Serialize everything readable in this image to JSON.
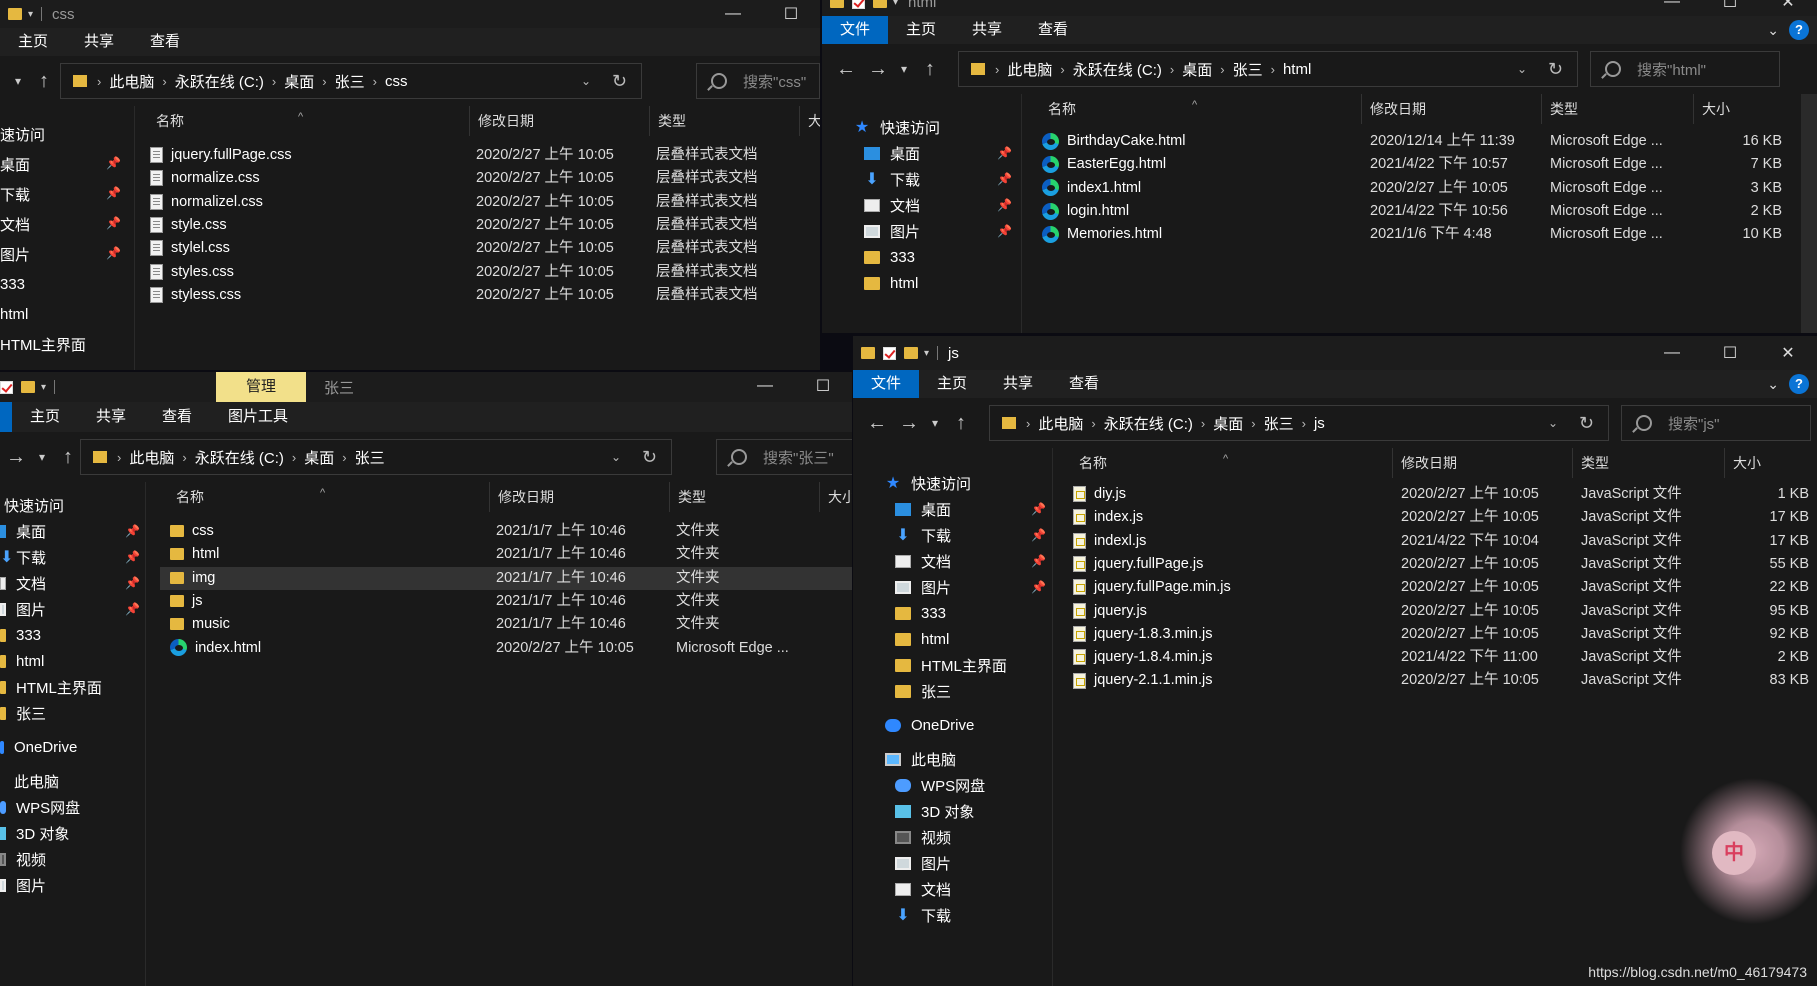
{
  "css_window": {
    "title": "css",
    "tabs": [
      "主页",
      "共享",
      "查看"
    ],
    "breadcrumb": [
      "此电脑",
      "永跃在线 (C:)",
      "桌面",
      "张三",
      "css"
    ],
    "search_placeholder": "搜索\"css\"",
    "sidebar": [
      "速访问",
      "桌面",
      "下载",
      "文档",
      "图片",
      "333",
      "html",
      "HTML主界面"
    ],
    "columns": [
      "名称",
      "修改日期",
      "类型",
      "大"
    ],
    "files": [
      {
        "name": "jquery.fullPage.css",
        "date": "2020/2/27 上午 10:05",
        "type": "层叠样式表文档"
      },
      {
        "name": "normalize.css",
        "date": "2020/2/27 上午 10:05",
        "type": "层叠样式表文档"
      },
      {
        "name": "normalizel.css",
        "date": "2020/2/27 上午 10:05",
        "type": "层叠样式表文档"
      },
      {
        "name": "style.css",
        "date": "2020/2/27 上午 10:05",
        "type": "层叠样式表文档"
      },
      {
        "name": "stylel.css",
        "date": "2020/2/27 上午 10:05",
        "type": "层叠样式表文档"
      },
      {
        "name": "styles.css",
        "date": "2020/2/27 上午 10:05",
        "type": "层叠样式表文档"
      },
      {
        "name": "styless.css",
        "date": "2020/2/27 上午 10:05",
        "type": "层叠样式表文档"
      }
    ]
  },
  "html_window": {
    "title": "html",
    "tabs": [
      "文件",
      "主页",
      "共享",
      "查看"
    ],
    "breadcrumb": [
      "此电脑",
      "永跃在线 (C:)",
      "桌面",
      "张三",
      "html"
    ],
    "search_placeholder": "搜索\"html\"",
    "sidebar": [
      "快速访问",
      "桌面",
      "下载",
      "文档",
      "图片",
      "333",
      "html"
    ],
    "columns": [
      "名称",
      "修改日期",
      "类型",
      "大小"
    ],
    "files": [
      {
        "name": "BirthdayCake.html",
        "date": "2020/12/14 上午 11:39",
        "type": "Microsoft Edge ...",
        "size": "16 KB"
      },
      {
        "name": "EasterEgg.html",
        "date": "2021/4/22 下午 10:57",
        "type": "Microsoft Edge ...",
        "size": "7 KB"
      },
      {
        "name": "index1.html",
        "date": "2020/2/27 上午 10:05",
        "type": "Microsoft Edge ...",
        "size": "3 KB"
      },
      {
        "name": "login.html",
        "date": "2021/4/22 下午 10:56",
        "type": "Microsoft Edge ...",
        "size": "2 KB"
      },
      {
        "name": "Memories.html",
        "date": "2021/1/6 下午 4:48",
        "type": "Microsoft Edge ...",
        "size": "10 KB"
      }
    ]
  },
  "zhangsan_window": {
    "title": "张三",
    "manage_tab": "管理",
    "tabs": [
      "主页",
      "共享",
      "查看",
      "图片工具"
    ],
    "breadcrumb": [
      "此电脑",
      "永跃在线 (C:)",
      "桌面",
      "张三"
    ],
    "search_placeholder": "搜索\"张三\"",
    "sidebar": [
      "快速访问",
      "桌面",
      "下载",
      "文档",
      "图片",
      "333",
      "html",
      "HTML主界面",
      "张三",
      "OneDrive",
      "此电脑",
      "WPS网盘",
      "3D 对象",
      "视频",
      "图片"
    ],
    "columns": [
      "名称",
      "修改日期",
      "类型",
      "大小"
    ],
    "files": [
      {
        "name": "css",
        "date": "2021/1/7 上午 10:46",
        "type": "文件夹",
        "kind": "folder"
      },
      {
        "name": "html",
        "date": "2021/1/7 上午 10:46",
        "type": "文件夹",
        "kind": "folder"
      },
      {
        "name": "img",
        "date": "2021/1/7 上午 10:46",
        "type": "文件夹",
        "kind": "folder"
      },
      {
        "name": "js",
        "date": "2021/1/7 上午 10:46",
        "type": "文件夹",
        "kind": "folder"
      },
      {
        "name": "music",
        "date": "2021/1/7 上午 10:46",
        "type": "文件夹",
        "kind": "folder"
      },
      {
        "name": "index.html",
        "date": "2020/2/27 上午 10:05",
        "type": "Microsoft Edge ...",
        "kind": "edge"
      }
    ]
  },
  "js_window": {
    "title": "js",
    "tabs": [
      "文件",
      "主页",
      "共享",
      "查看"
    ],
    "breadcrumb": [
      "此电脑",
      "永跃在线 (C:)",
      "桌面",
      "张三",
      "js"
    ],
    "search_placeholder": "搜索\"js\"",
    "sidebar": [
      "快速访问",
      "桌面",
      "下载",
      "文档",
      "图片",
      "333",
      "html",
      "HTML主界面",
      "张三",
      "OneDrive",
      "此电脑",
      "WPS网盘",
      "3D 对象",
      "视频",
      "图片",
      "文档",
      "下载"
    ],
    "columns": [
      "名称",
      "修改日期",
      "类型",
      "大小"
    ],
    "files": [
      {
        "name": "diy.js",
        "date": "2020/2/27 上午 10:05",
        "type": "JavaScript 文件",
        "size": "1 KB"
      },
      {
        "name": "index.js",
        "date": "2020/2/27 上午 10:05",
        "type": "JavaScript 文件",
        "size": "17 KB"
      },
      {
        "name": "indexl.js",
        "date": "2021/4/22 下午 10:04",
        "type": "JavaScript 文件",
        "size": "17 KB"
      },
      {
        "name": "jquery.fullPage.js",
        "date": "2020/2/27 上午 10:05",
        "type": "JavaScript 文件",
        "size": "55 KB"
      },
      {
        "name": "jquery.fullPage.min.js",
        "date": "2020/2/27 上午 10:05",
        "type": "JavaScript 文件",
        "size": "22 KB"
      },
      {
        "name": "jquery.js",
        "date": "2020/2/27 上午 10:05",
        "type": "JavaScript 文件",
        "size": "95 KB"
      },
      {
        "name": "jquery-1.8.3.min.js",
        "date": "2020/2/27 上午 10:05",
        "type": "JavaScript 文件",
        "size": "92 KB"
      },
      {
        "name": "jquery-1.8.4.min.js",
        "date": "2021/4/22 下午 11:00",
        "type": "JavaScript 文件",
        "size": "2 KB"
      },
      {
        "name": "jquery-2.1.1.min.js",
        "date": "2020/2/27 上午 10:05",
        "type": "JavaScript 文件",
        "size": "83 KB"
      }
    ]
  },
  "watermark": "https://blog.csdn.net/m0_46179473",
  "badge_char": "中"
}
